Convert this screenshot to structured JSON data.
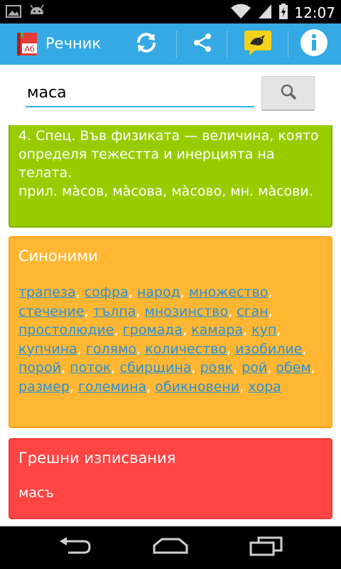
{
  "status_bar": {
    "time": "12:07",
    "icons": [
      "image-icon",
      "android-icon",
      "wifi-icon",
      "signal-icon",
      "battery-charging-icon"
    ]
  },
  "action_bar": {
    "title": "Речник",
    "app_icon_text": "Аб",
    "actions": [
      "refresh-icon",
      "share-icon",
      "bird-chat-icon",
      "info-icon"
    ],
    "colors": {
      "background": "#34a9e3"
    }
  },
  "search": {
    "value": "маса",
    "button_icon": "search-icon"
  },
  "definition": {
    "line1": "4. Спец. Във физиката — величина, която определя тежестта и инерцията на телата.",
    "line2": "прил. мàсов, мàсова, мàсово, мн. мàсови."
  },
  "synonyms": {
    "title": "Синоними",
    "items": [
      "трапеза",
      "софра",
      "народ",
      "множество",
      "стечение",
      "тълпа",
      "мнозинство",
      "сган",
      "простолюдие",
      "громада",
      "камара",
      "куп",
      "купчина",
      "голямо",
      "количество",
      "изобилие",
      "порой",
      "поток",
      "сбирщина",
      "рояк",
      "рой",
      "обем",
      "размер",
      "големина",
      "обикновени",
      "хора"
    ],
    "colors": {
      "background": "#ffb733",
      "link": "#2a90d8"
    }
  },
  "misspellings": {
    "title": "Грешни изписвания",
    "items": [
      "масъ"
    ],
    "colors": {
      "background": "#ff4444"
    }
  },
  "definition_colors": {
    "background": "#99cc00"
  },
  "nav_bar": {
    "buttons": [
      "back-icon",
      "home-icon",
      "recent-apps-icon"
    ]
  }
}
